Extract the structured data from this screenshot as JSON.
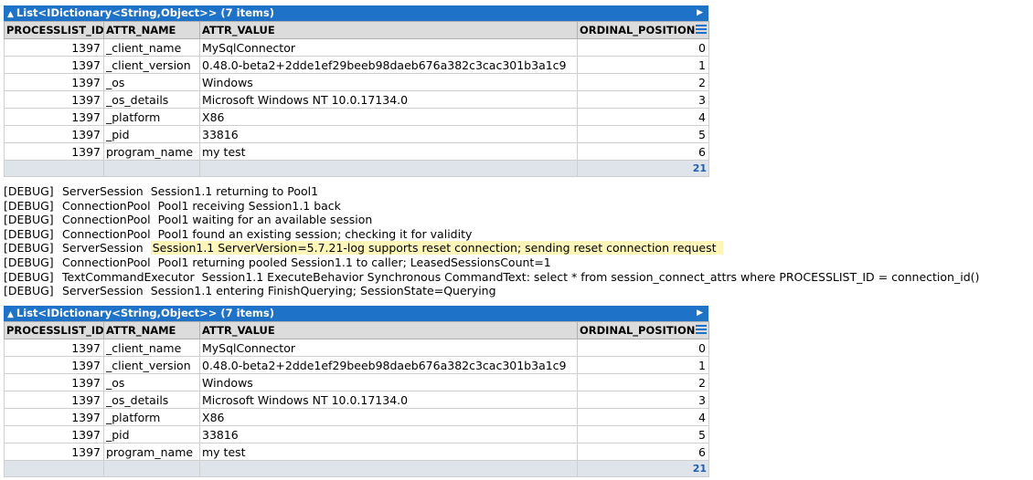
{
  "grid1": {
    "title": "List<IDictionary<String,Object>> (7 items)",
    "columns": [
      "PROCESSLIST_ID",
      "ATTR_NAME",
      "ATTR_VALUE",
      "ORDINAL_POSITION"
    ],
    "rows": [
      [
        "1397",
        "_client_name",
        "MySqlConnector",
        "0"
      ],
      [
        "1397",
        "_client_version",
        "0.48.0-beta2+2dde1ef29beeb98daeb676a382c3cac301b3a1c9",
        "1"
      ],
      [
        "1397",
        "_os",
        "Windows",
        "2"
      ],
      [
        "1397",
        "_os_details",
        "Microsoft Windows NT 10.0.17134.0",
        "3"
      ],
      [
        "1397",
        "_platform",
        "X86",
        "4"
      ],
      [
        "1397",
        "_pid",
        "33816",
        "5"
      ],
      [
        "1397",
        "program_name",
        "my test",
        "6"
      ]
    ],
    "footer_total": "21"
  },
  "log": [
    {
      "level": "[DEBUG]",
      "source": "ServerSession",
      "message": "Session1.1 returning to Pool1",
      "highlight": false
    },
    {
      "level": "[DEBUG]",
      "source": "ConnectionPool",
      "message": "Pool1 receiving Session1.1 back",
      "highlight": false
    },
    {
      "level": "[DEBUG]",
      "source": "ConnectionPool",
      "message": "Pool1 waiting for an available session",
      "highlight": false
    },
    {
      "level": "[DEBUG]",
      "source": "ConnectionPool",
      "message": "Pool1 found an existing session; checking it for validity",
      "highlight": false
    },
    {
      "level": "[DEBUG]",
      "source": "ServerSession",
      "message": "Session1.1 ServerVersion=5.7.21-log supports reset connection; sending reset connection request",
      "highlight": true
    },
    {
      "level": "[DEBUG]",
      "source": "ConnectionPool",
      "message": "Pool1 returning pooled Session1.1 to caller; LeasedSessionsCount=1",
      "highlight": false
    },
    {
      "level": "[DEBUG]",
      "source": "TextCommandExecutor",
      "message": "Session1.1 ExecuteBehavior Synchronous CommandText: select * from session_connect_attrs where PROCESSLIST_ID = connection_id()",
      "highlight": false
    },
    {
      "level": "[DEBUG]",
      "source": "ServerSession",
      "message": "Session1.1 entering FinishQuerying; SessionState=Querying",
      "highlight": false
    }
  ],
  "grid2": {
    "title": "List<IDictionary<String,Object>> (7 items)",
    "columns": [
      "PROCESSLIST_ID",
      "ATTR_NAME",
      "ATTR_VALUE",
      "ORDINAL_POSITION"
    ],
    "rows": [
      [
        "1397",
        "_client_name",
        "MySqlConnector",
        "0"
      ],
      [
        "1397",
        "_client_version",
        "0.48.0-beta2+2dde1ef29beeb98daeb676a382c3cac301b3a1c9",
        "1"
      ],
      [
        "1397",
        "_os",
        "Windows",
        "2"
      ],
      [
        "1397",
        "_os_details",
        "Microsoft Windows NT 10.0.17134.0",
        "3"
      ],
      [
        "1397",
        "_platform",
        "X86",
        "4"
      ],
      [
        "1397",
        "_pid",
        "33816",
        "5"
      ],
      [
        "1397",
        "program_name",
        "my test",
        "6"
      ]
    ],
    "footer_total": "21"
  },
  "icons": {
    "collapse": "triangle-up-icon",
    "expand": "triangle-right-icon",
    "column_menu": "menu-icon"
  },
  "colors": {
    "header_blue": "#1e72c8",
    "highlight": "#fdf6b8",
    "footer_count": "#1e5fae"
  }
}
